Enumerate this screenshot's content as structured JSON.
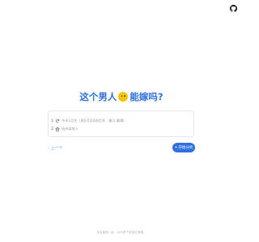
{
  "header": {
    "github_icon": "github-icon"
  },
  "title": {
    "before": "这个男人",
    "emoji": "smiley-emoji",
    "after": "能嫁吗?"
  },
  "card": {
    "rows": [
      {
        "number": "1.",
        "icon": "refresh-icon",
        "text": "今年1月生（农历5月6前后到 - 属马 摩羯）"
      },
      {
        "number": "2.",
        "icon": "home-icon",
        "text": "杭州本地人"
      }
    ]
  },
  "actions": {
    "prev_label": "上一个",
    "start_label": "开始分析"
  },
  "footer": {
    "text": "结合星座八卦，AI为您下定结论良缘。"
  },
  "colors": {
    "accent": "#2f6fe0",
    "muted": "#9a9a9a"
  }
}
